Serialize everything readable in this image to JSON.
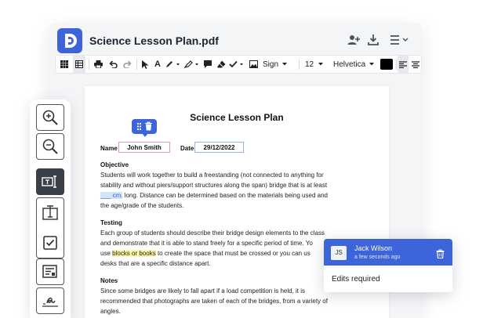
{
  "window": {
    "document_title": "Science Lesson Plan.pdf",
    "icons": [
      "add-user-icon",
      "download-icon",
      "menu-icon",
      "chevron-down-icon"
    ]
  },
  "toolbar": {
    "sign_label": "Sign",
    "font_size": "12",
    "font_family": "Helvetica",
    "text_color": "#000000",
    "icons": [
      "grid-view-icon",
      "page-layout-icon",
      "print-icon",
      "undo-icon",
      "redo-icon",
      "pointer-icon",
      "text-icon",
      "pen-icon",
      "highlighter-icon",
      "comment-icon",
      "eraser-icon",
      "checkmark-icon",
      "image-icon",
      "align-left-icon",
      "align-center-icon"
    ]
  },
  "document": {
    "heading": "Science Lesson Plan",
    "name_label": "Name",
    "name_value": "John Smith",
    "date_label": "Date",
    "date_value": "29/12/2022",
    "objective": {
      "title": "Objective",
      "line1": "Students will work together to build a freestanding (not connected to anything for",
      "line2": "stability and without piers/support structures along the span) bridge that is at least",
      "line3_highlight": "___ cm.",
      "line3_rest": " long. Distance can be determined based on the materials being used and",
      "line4": "the age/grade of the students."
    },
    "testing": {
      "title": "Testing",
      "line1": "Each group of students should describe their bridge design elements to the class",
      "line2": "and demonstrate that it is able to stand freely for a specific period of time. Yo",
      "line3_pre": "use ",
      "line3_highlight": "blocks or books",
      "line3_post": " to create the space that must be crossed or you can us",
      "line4": "desks that are a specific distance apart."
    },
    "notes": {
      "title": "Notes",
      "line1": "Since some bridges are likely to fall apart if a load competition is held, it is",
      "line2": "recommended that photographs are taken of each of the bridges, from a variety of",
      "line3": "angles."
    }
  },
  "tool_panel": {
    "tools": [
      "zoom-in",
      "zoom-out",
      "text-field",
      "text-box",
      "checkbox",
      "form-field",
      "signature"
    ]
  },
  "comment": {
    "initials": "JS",
    "author": "Jack Wilson",
    "time": "a few seconds ago",
    "text": "Edits required"
  },
  "colors": {
    "accent": "#3d64d8",
    "name_field_border": "#e59aa9",
    "date_field_border": "#8bb8e8",
    "highlight_yellow": "#fbf5a8",
    "highlight_blue": "#d4e4f8"
  }
}
